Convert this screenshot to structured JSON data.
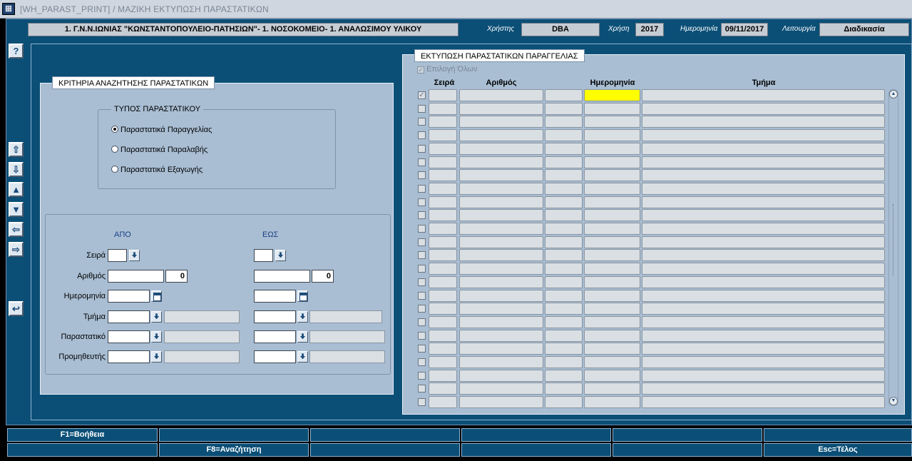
{
  "window": {
    "title": "[WH_PARAST_PRINT]  /  ΜΑΖΙΚΗ ΕΚΤΥΠΩΣΗ ΠΑΡΑΣΤΑΤΙΚΩΝ"
  },
  "header": {
    "org": "1. Γ.Ν.Ν.ΙΩΝΙΑΣ \"ΚΩΝΣΤΑΝΤΟΠΟΥΛΕΙΟ-ΠΑΤΗΣΙΩΝ\"- 1. ΝΟΣΟΚΟΜΕΙΟ- 1. ΑΝΑΛΩΣΙΜΟΥ ΥΛΙΚΟΥ",
    "user_label": "Χρήστης",
    "user_value": "DBA",
    "year_label": "Χρήση",
    "year_value": "2017",
    "date_label": "Ημερομηνία",
    "date_value": "09/11/2017",
    "mode_label": "Λειτουργία",
    "mode_value": "Διαδικασία"
  },
  "side": {
    "help": "?",
    "btns": [
      "first-record",
      "next-record",
      "prev-block",
      "next-block",
      "prev-field",
      "next-field",
      "exit"
    ]
  },
  "criteria": {
    "title": "ΚΡΙΤΗΡΙΑ ΑΝΑΖΗΤΗΣΗΣ ΠΑΡΑΣΤΑΤΙΚΩΝ",
    "type_title": "ΤΥΠΟΣ ΠΑΡΑΣΤΑΤΙΚΟΥ",
    "types": [
      {
        "label": "Παραστατικά Παραγγελίας",
        "selected": true
      },
      {
        "label": "Παραστατικά Παραλαβής",
        "selected": false
      },
      {
        "label": "Παραστατικά Εξαγωγής",
        "selected": false
      }
    ],
    "from_label": "ΑΠΟ",
    "to_label": "ΕΩΣ",
    "fields": {
      "seira": "Σειρά",
      "arithmos": "Αριθμός",
      "hmerominia": "Ημερομηνία",
      "tmima": "Τμήμα",
      "parastatiko": "Παραστατικό",
      "promitheftis": "Προμηθευτής"
    },
    "from_number_value": "0",
    "to_number_value": "0"
  },
  "print": {
    "title": "ΕΚΤΥΠΩΣΗ ΠΑΡΑΣΤΑΤΙΚΩΝ ΠΑΡΑΓΓΕΛΙΑΣ",
    "select_all": "Επιλογή Όλων",
    "columns": [
      "Σειρά",
      "Αριθμός",
      "Ημερομηνία",
      "Τμήμα"
    ],
    "row_count": 24,
    "highlight_color": "#ffff00"
  },
  "fkeys": {
    "row1": [
      "F1=Βοήθεια",
      "",
      "",
      "",
      "",
      ""
    ],
    "row2": [
      "",
      "F8=Αναζήτηση",
      "",
      "",
      "",
      "Esc=Τέλος"
    ]
  },
  "colors": {
    "background": "#0b4f77",
    "frame": "#a9bed3",
    "header_box": "#c6ccd4"
  }
}
